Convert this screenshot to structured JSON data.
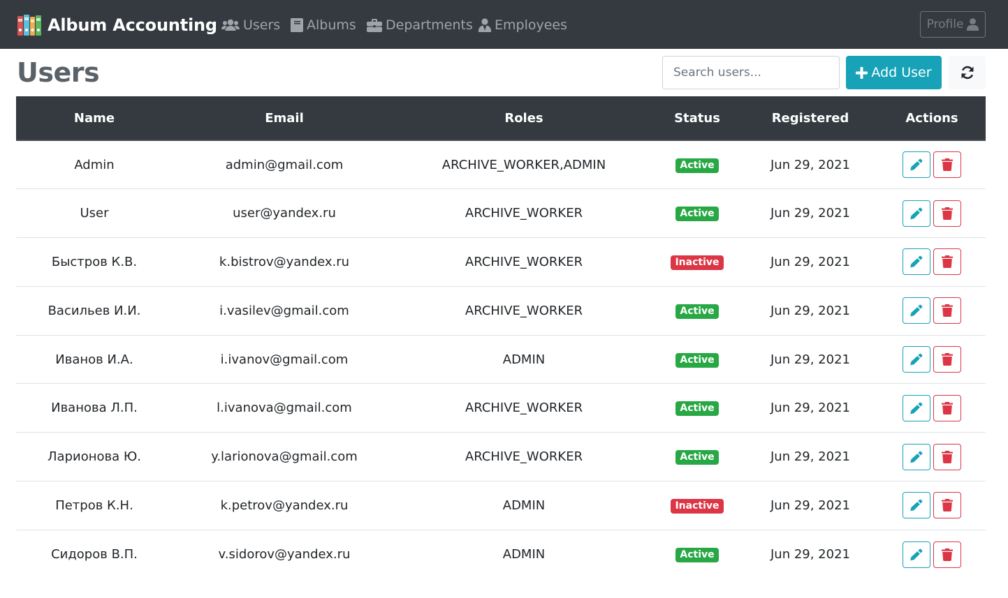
{
  "navbar": {
    "brand": "Album Accounting",
    "links": [
      {
        "label": "Users",
        "icon": "users-icon"
      },
      {
        "label": "Albums",
        "icon": "book-icon"
      },
      {
        "label": "Departments",
        "icon": "briefcase-icon"
      },
      {
        "label": "Employees",
        "icon": "user-tie-icon"
      }
    ],
    "profile_label": "Profile",
    "colors": {
      "background": "#343a40",
      "link": "#a0a4a8"
    }
  },
  "page": {
    "title": "Users",
    "search_placeholder": "Search users...",
    "add_label": "Add User",
    "accent": "#17a2b8"
  },
  "table": {
    "headers": [
      "Name",
      "Email",
      "Roles",
      "Status",
      "Registered",
      "Actions"
    ],
    "rows": [
      {
        "name": "Admin",
        "email": "admin@gmail.com",
        "roles": "ARCHIVE_WORKER,ADMIN",
        "status": "Active",
        "registered": "Jun 29, 2021"
      },
      {
        "name": "User",
        "email": "user@yandex.ru",
        "roles": "ARCHIVE_WORKER",
        "status": "Active",
        "registered": "Jun 29, 2021"
      },
      {
        "name": "Быстров К.В.",
        "email": "k.bistrov@yandex.ru",
        "roles": "ARCHIVE_WORKER",
        "status": "Inactive",
        "registered": "Jun 29, 2021"
      },
      {
        "name": "Васильев И.И.",
        "email": "i.vasilev@gmail.com",
        "roles": "ARCHIVE_WORKER",
        "status": "Active",
        "registered": "Jun 29, 2021"
      },
      {
        "name": "Иванов И.А.",
        "email": "i.ivanov@gmail.com",
        "roles": "ADMIN",
        "status": "Active",
        "registered": "Jun 29, 2021"
      },
      {
        "name": "Иванова Л.П.",
        "email": "l.ivanova@gmail.com",
        "roles": "ARCHIVE_WORKER",
        "status": "Active",
        "registered": "Jun 29, 2021"
      },
      {
        "name": "Ларионова Ю.",
        "email": "y.larionova@gmail.com",
        "roles": "ARCHIVE_WORKER",
        "status": "Active",
        "registered": "Jun 29, 2021"
      },
      {
        "name": "Петров К.Н.",
        "email": "k.petrov@yandex.ru",
        "roles": "ADMIN",
        "status": "Inactive",
        "registered": "Jun 29, 2021"
      },
      {
        "name": "Сидоров В.П.",
        "email": "v.sidorov@yandex.ru",
        "roles": "ADMIN",
        "status": "Active",
        "registered": "Jun 29, 2021"
      }
    ],
    "status_colors": {
      "Active": "#28a745",
      "Inactive": "#dc3545"
    },
    "row_actions": [
      {
        "icon": "pencil-icon",
        "color": "#17a2b8"
      },
      {
        "icon": "trash-icon",
        "color": "#dc3545"
      }
    ]
  }
}
